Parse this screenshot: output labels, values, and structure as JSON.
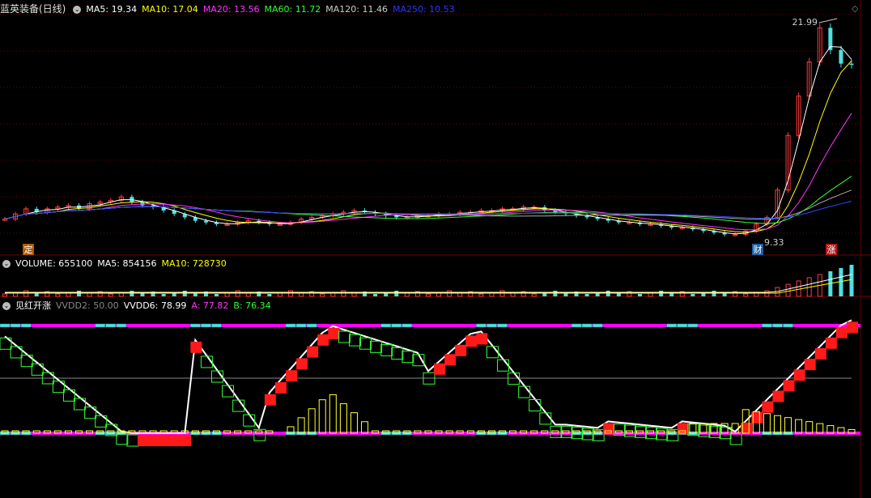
{
  "price_panel": {
    "title": "蓝英装备(日线)",
    "ma_labels": [
      {
        "text": "MA5: 19.34",
        "color": "#ffffff"
      },
      {
        "text": "MA10: 17.04",
        "color": "#ffff00"
      },
      {
        "text": "MA20: 13.56",
        "color": "#ff33ff"
      },
      {
        "text": "MA60: 11.72",
        "color": "#33ff33"
      },
      {
        "text": "MA120: 11.46",
        "color": "#cccccc"
      },
      {
        "text": "MA250: 10.53",
        "color": "#3333ff"
      }
    ],
    "high_label": "21.99",
    "low_label": "9.33",
    "badge_left": "定",
    "badge_mid": "财",
    "badge_right": "涨",
    "diamond_icon": "◇"
  },
  "volume_panel": {
    "title": "VOLUME: 655100",
    "ma5": "MA5: 854156",
    "ma10": "MA10: 728730",
    "colors": {
      "title": "#ffffff",
      "ma5": "#ffffff",
      "ma10": "#ffff00"
    }
  },
  "indicator_panel": {
    "title": "见红开涨",
    "labels": [
      {
        "text": "VVDD2: 50.00",
        "color": "#888888"
      },
      {
        "text": "VVDD6: 78.99",
        "color": "#ffffff"
      },
      {
        "text": "A: 77.82",
        "color": "#ff33ff"
      },
      {
        "text": "B: 76.34",
        "color": "#33ff33"
      }
    ]
  },
  "chart_data": {
    "type": "candlestick",
    "ylim": [
      9.33,
      21.99
    ],
    "closes": [
      10.3,
      10.6,
      10.9,
      10.7,
      10.9,
      11.0,
      11.1,
      10.9,
      11.2,
      11.3,
      11.4,
      11.6,
      11.3,
      11.1,
      11.0,
      10.8,
      10.6,
      10.4,
      10.2,
      10.1,
      10.0,
      10.0,
      10.1,
      10.2,
      10.1,
      10.0,
      10.0,
      10.1,
      10.3,
      10.4,
      10.5,
      10.6,
      10.7,
      10.8,
      10.7,
      10.6,
      10.5,
      10.4,
      10.4,
      10.5,
      10.5,
      10.6,
      10.6,
      10.7,
      10.7,
      10.8,
      10.8,
      10.9,
      10.9,
      11.0,
      11.0,
      10.8,
      10.7,
      10.6,
      10.5,
      10.4,
      10.3,
      10.2,
      10.1,
      10.1,
      10.0,
      10.0,
      9.9,
      9.8,
      9.8,
      9.7,
      9.6,
      9.5,
      9.4,
      9.4,
      9.6,
      10.0,
      10.4,
      12.0,
      15.2,
      17.5,
      19.5,
      21.5,
      20.2,
      19.4,
      19.34
    ],
    "ma_series": [
      "MA5",
      "MA10",
      "MA20",
      "MA60",
      "MA120",
      "MA250"
    ]
  }
}
